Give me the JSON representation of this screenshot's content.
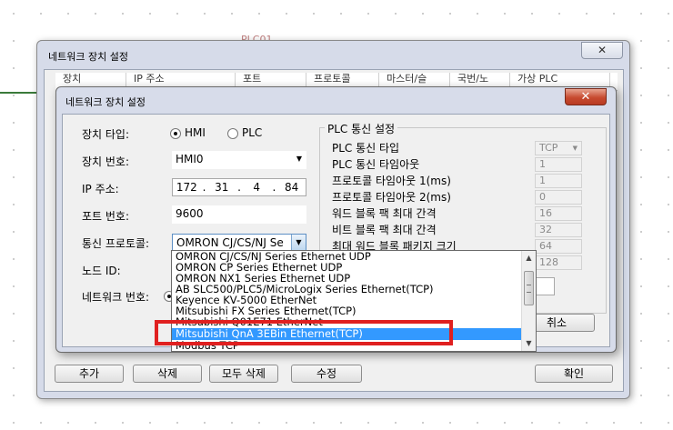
{
  "background": {
    "label": "PLC01"
  },
  "outer_dialog": {
    "title": "네트워크 장치 설정",
    "close_icon": "close-icon",
    "columns": [
      "장치",
      "IP 주소",
      "포트",
      "프로토콜",
      "마스터/슬",
      "국번/노",
      "가상 PLC"
    ],
    "buttons": {
      "add": "추가",
      "delete": "삭제",
      "delete_all": "모두 삭제",
      "edit": "수정",
      "ok": "확인"
    }
  },
  "inner_dialog": {
    "title": "네트워크 장치 설정",
    "close_icon": "close-icon",
    "device_type": {
      "label": "장치 타입:",
      "options": [
        "HMI",
        "PLC"
      ],
      "selected": "HMI"
    },
    "device_number": {
      "label": "장치 번호:",
      "value": "HMI0"
    },
    "ip_address": {
      "label": "IP 주소:",
      "octets": [
        "172",
        "31",
        "4",
        "84"
      ]
    },
    "port": {
      "label": "포트 번호:",
      "value": "9600"
    },
    "protocol": {
      "label": "통신 프로토콜:",
      "value": "OMRON CJ/CS/NJ Se"
    },
    "node_id": {
      "label": "노드 ID:"
    },
    "network_number": {
      "label": "네트워크 번호:"
    },
    "cancel_label": "취소",
    "plc_settings": {
      "title": "PLC 통신 설정",
      "rows": [
        {
          "label": "PLC 통신 타입",
          "value": "TCP"
        },
        {
          "label": "PLC 통신 타임아웃",
          "value": "1"
        },
        {
          "label": "프로토콜 타임아웃 1(ms)",
          "value": "1"
        },
        {
          "label": "프로토콜 타임아웃 2(ms)",
          "value": "0"
        },
        {
          "label": "워드 블록 팩 최대 간격",
          "value": "16"
        },
        {
          "label": "비트 블록 팩 최대 간격",
          "value": "32"
        },
        {
          "label": "최대 워드 블록 패키지 크기",
          "value": "64"
        },
        {
          "label": "",
          "value": "128"
        }
      ]
    }
  },
  "protocol_dropdown": {
    "items": [
      "OMRON CJ/CS/NJ Series Ethernet UDP",
      "OMRON CP Series Ethernet UDP",
      "OMRON NX1 Series Ethernet UDP",
      "AB SLC500/PLC5/MicroLogix Series Ethernet(TCP)",
      "Keyence KV-5000 EtherNet",
      "Mitsubishi FX Series Ethernet(TCP)",
      "Mitsubishi Q01E71 EtherNet",
      "Mitsubishi QnA 3EBin Ethernet(TCP)",
      "Modbus TCP"
    ],
    "selected_index": 7
  }
}
